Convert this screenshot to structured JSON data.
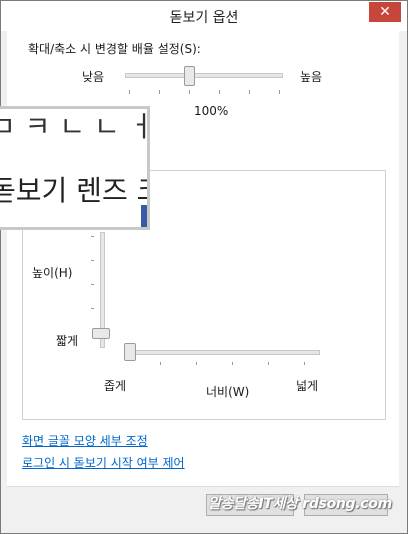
{
  "window": {
    "title": "돋보기 옵션",
    "close_glyph": "✕"
  },
  "zoom": {
    "label": "확대/축소 시 변경할 배율 설정(S):",
    "low_label": "낮음",
    "high_label": "높음",
    "value": "100%",
    "level": 0.4
  },
  "lens_size": {
    "height_label": "높이(H)",
    "height_short_label": "짧게",
    "width_narrow_label": "좁게",
    "width_label": "너비(W)",
    "width_wide_label": "넓게"
  },
  "lens_preview": {
    "line1": "ㅁ ㅋ ㄴ ㄴ ㅓ",
    "line2": "돋보기 렌즈 크"
  },
  "links": {
    "font_tuning": "화면 글꼴 모양 세부 조정",
    "logon_magnifier": "로그인 시 돋보기 시작 여부 제어"
  },
  "buttons": {
    "ok": "",
    "cancel": ""
  },
  "watermark": "알송달송IT세상 rdsong.com",
  "colors": {
    "close": "#c7463a",
    "link": "#0066cc",
    "accent": "#3a5aa8"
  }
}
